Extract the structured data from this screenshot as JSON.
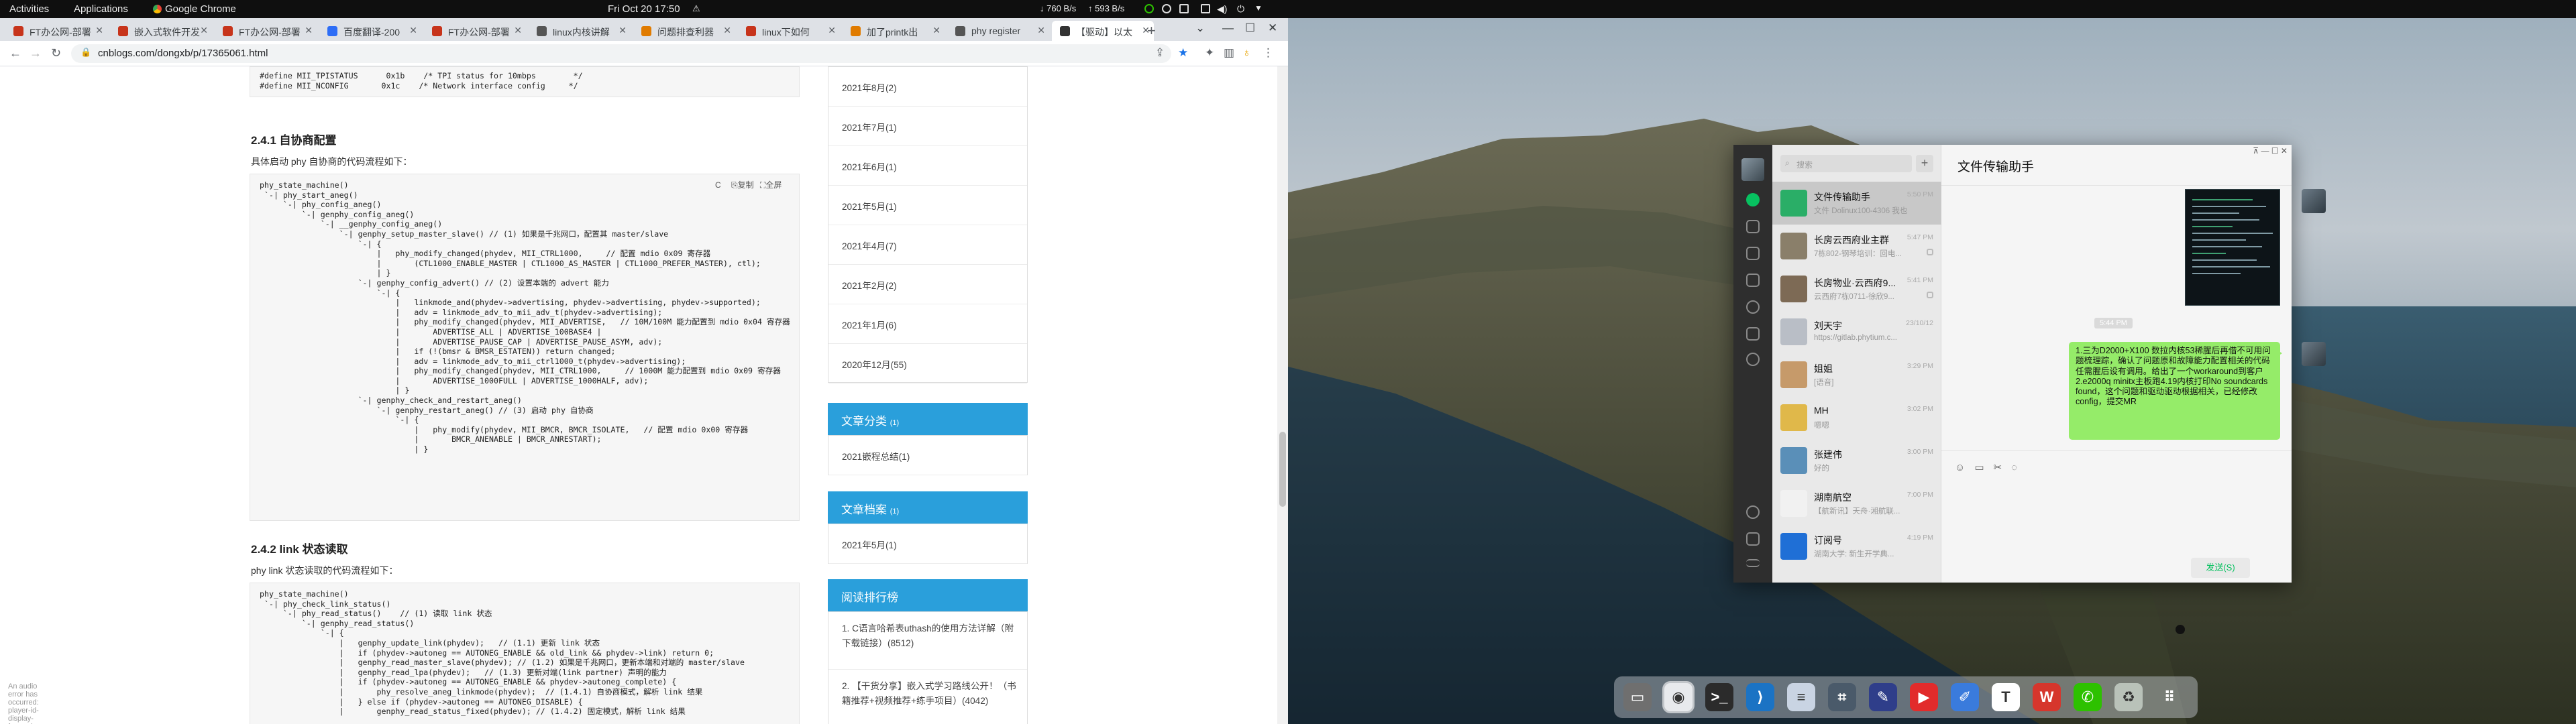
{
  "topbar": {
    "activities": "Activities",
    "applications": "Applications",
    "app_name": "Google Chrome",
    "clock": "Fri Oct 20  17:50",
    "net_down": "760 B/s",
    "net_up": "593 B/s"
  },
  "tabs": [
    {
      "label": "FT办公网-部署",
      "color": "#c7341b"
    },
    {
      "label": "嵌入式软件开发",
      "color": "#c7341b"
    },
    {
      "label": "FT办公网-部署",
      "color": "#c7341b"
    },
    {
      "label": "百度翻译-200",
      "color": "#2d6df6"
    },
    {
      "label": "FT办公网-部署",
      "color": "#c7341b"
    },
    {
      "label": "linux内核讲解",
      "color": "#555555"
    },
    {
      "label": "问题排查利器",
      "color": "#e07b00"
    },
    {
      "label": "linux下如何",
      "color": "#c7341b"
    },
    {
      "label": "加了printk出",
      "color": "#e07b00"
    },
    {
      "label": "phy register",
      "color": "#555555"
    },
    {
      "label": "【驱动】以太",
      "color": "#333333"
    }
  ],
  "address": {
    "url": "cnblogs.com/dongxb/p/17365061.html"
  },
  "article": {
    "top_code": [
      "#define MII_TPISTATUS      0x1b    /* TPI status for 10mbps        */",
      "#define MII_NCONFIG       0x1c    /* Network interface config     */"
    ],
    "sec1_title": "2.4.1 自协商配置",
    "sec1_desc": "具体启动 phy 自协商的代码流程如下：",
    "code_copy": "复制",
    "code_full": "全屏",
    "code_c": "C",
    "code1": [
      "phy_state_machine()",
      " `-| phy_start_aneg()",
      "     `-| phy_config_aneg()",
      "         `-| genphy_config_aneg()",
      "             `-| __genphy_config_aneg()",
      "                 `-| genphy_setup_master_slave() // (1) 如果是千兆网口，配置其 master/slave",
      "                     `-| {",
      "                         |   phy_modify_changed(phydev, MII_CTRL1000,     // 配置 mdio 0x09 寄存器",
      "                         |       (CTL1000_ENABLE_MASTER | CTL1000_AS_MASTER | CTL1000_PREFER_MASTER), ctl);",
      "                         | }",
      "                     `-| genphy_config_advert() // (2) 设置本端的 advert 能力",
      "                         `-| {",
      "                             |   linkmode_and(phydev->advertising, phydev->advertising, phydev->supported);",
      "                             |   adv = linkmode_adv_to_mii_adv_t(phydev->advertising);",
      "                             |   phy_modify_changed(phydev, MII_ADVERTISE,   // 10M/100M 能力配置到 mdio 0x04 寄存器",
      "                             |       ADVERTISE_ALL | ADVERTISE_100BASE4 |",
      "                             |       ADVERTISE_PAUSE_CAP | ADVERTISE_PAUSE_ASYM, adv);",
      "                             |   if (!(bmsr & BMSR_ESTATEN)) return changed;",
      "                             |   adv = linkmode_adv_to_mii_ctrl1000_t(phydev->advertising);",
      "                             |   phy_modify_changed(phydev, MII_CTRL1000,     // 1000M 能力配置到 mdio 0x09 寄存器",
      "                             |       ADVERTISE_1000FULL | ADVERTISE_1000HALF, adv);",
      "                             | }",
      "                     `-| genphy_check_and_restart_aneg()",
      "                         `-| genphy_restart_aneg() // (3) 启动 phy 自协商",
      "                             `-| {",
      "                                 |   phy_modify(phydev, MII_BMCR, BMCR_ISOLATE,   // 配置 mdio 0x00 寄存器",
      "                                 |       BMCR_ANENABLE | BMCR_ANRESTART);",
      "                                 | }"
    ],
    "sec2_title": "2.4.2 link 状态读取",
    "sec2_desc": "phy link 状态读取的代码流程如下：",
    "code2": [
      "phy_state_machine()",
      " `-| phy_check_link_status()",
      "     `-| phy_read_status()    // (1) 读取 link 状态",
      "         `-| genphy_read_status()",
      "             `-| {",
      "                 |   genphy_update_link(phydev);   // (1.1) 更新 link 状态",
      "                 |   if (phydev->autoneg == AUTONEG_ENABLE && old_link && phydev->link) return 0;",
      "                 |   genphy_read_master_slave(phydev); // (1.2) 如果是千兆网口，更新本端和对端的 master/slave",
      "                 |   genphy_read_lpa(phydev);   // (1.3) 更新对端(link partner) 声明的能力",
      "                 |   if (phydev->autoneg == AUTONEG_ENABLE && phydev->autoneg_complete) {",
      "                 |       phy_resolve_aneg_linkmode(phydev);  // (1.4.1) 自协商模式，解析 link 结果",
      "                 |   } else if (phydev->autoneg == AUTONEG_DISABLE) {",
      "                 |       genphy_read_status_fixed(phydev); // (1.4.2) 固定模式，解析 link 结果"
    ],
    "ad_text": "An audio error has occurred: player-id-display-forward"
  },
  "sidebar": {
    "archive_rows": [
      "2021年8月(2)",
      "2021年7月(1)",
      "2021年6月(1)",
      "2021年5月(1)",
      "2021年4月(7)",
      "2021年2月(2)",
      "2021年1月(6)",
      "2020年12月(55)"
    ],
    "category_title": "文章分类",
    "category_count": "(1)",
    "category_rows": [
      "2021嵌程总结(1)"
    ],
    "file_title": "文章档案",
    "file_count": "(1)",
    "file_rows": [
      "2021年5月(1)"
    ],
    "rank_title": "阅读排行榜",
    "rank_rows": [
      "1. C语言哈希表uthash的使用方法详解（附下载链接）(8512)",
      "2. 【干货分享】嵌入式学习路线公开！（书籍推荐+视频推荐+练手项目）(4042)"
    ]
  },
  "wechat": {
    "search_placeholder": "搜索",
    "plus": "+",
    "title": "文件传输助手",
    "titlebar_controls": "⊼  —  ☐  ✕",
    "chats": [
      {
        "name": "文件传输助手",
        "preview": "文件 Dolinux100-4306 我也...",
        "time": "5:50 PM",
        "color": "#2aae67",
        "selected": true
      },
      {
        "name": "长房云西府业主群",
        "preview": "7栋802-钢琴培训：回电...",
        "time": "5:47 PM",
        "color": "#8a7f6a",
        "muted": true
      },
      {
        "name": "长房物业·云西府9...",
        "preview": "云西府7栋0711-徐欣9...",
        "time": "5:41 PM",
        "color": "#7d6a55",
        "muted": true
      },
      {
        "name": "刘天宇",
        "preview": "https://gitlab.phytium.c...",
        "time": "23/10/12",
        "color": "#b9bec6"
      },
      {
        "name": "姐姐",
        "preview": "[语音]",
        "time": "3:29 PM",
        "color": "#c69a6a"
      },
      {
        "name": "MH",
        "preview": "嗯嗯",
        "time": "3:02 PM",
        "color": "#e0b84a"
      },
      {
        "name": "张建伟",
        "preview": "好的",
        "time": "3:00 PM",
        "color": "#5a8fb8"
      },
      {
        "name": "湖南航空",
        "preview": "【航新讯】天舟·湘航联...",
        "time": "7:00 PM",
        "color": "#f1f1f1"
      },
      {
        "name": "订阅号",
        "preview": "湖南大学: 新生开学典...",
        "time": "4:19 PM",
        "color": "#1f6fd6"
      }
    ],
    "timestamp": "5:44 PM",
    "message": "1.三为D2000+X100 数拉内核53稀腥后再借不可用问题梳理踪，确认了问题原和故障能力配置相关的代码任需腥后设有调用。给出了一个workaround到客户\n2.e2000q minitx主板跑4.19内核打印No soundcards found，这个问题和驱动驱动根据相关，已经修改config，提交MR",
    "send_label": "发送(S)"
  },
  "dock": [
    {
      "icon": "files-icon",
      "color": "#6f6f6f",
      "glyph": "▭"
    },
    {
      "icon": "chrome-icon",
      "color": "#e8eaed",
      "glyph": "◉",
      "active": true
    },
    {
      "icon": "terminal-icon",
      "color": "#2b2b2b",
      "glyph": ">_"
    },
    {
      "icon": "vscode-icon",
      "color": "#1b73c4",
      "glyph": "⟩"
    },
    {
      "icon": "text-editor-icon",
      "color": "#c9d4e3",
      "glyph": "≡"
    },
    {
      "icon": "screenshot-icon",
      "color": "#4a5a6a",
      "glyph": "⌗"
    },
    {
      "icon": "kolourpaint-icon",
      "color": "#2f3e8a",
      "glyph": "✎"
    },
    {
      "icon": "music-icon",
      "color": "#e22b2b",
      "glyph": "▶"
    },
    {
      "icon": "notes-icon",
      "color": "#3a7bdc",
      "glyph": "✐"
    },
    {
      "icon": "typora-icon",
      "color": "#ffffff",
      "glyph": "T"
    },
    {
      "icon": "wps-icon",
      "color": "#d6362c",
      "glyph": "W"
    },
    {
      "icon": "wechat-icon",
      "color": "#2dc100",
      "glyph": "✆"
    },
    {
      "icon": "recycle-icon",
      "color": "#b9c2b9",
      "glyph": "♻"
    },
    {
      "icon": "app-grid-icon",
      "color": "transparent",
      "glyph": "⠿"
    }
  ]
}
